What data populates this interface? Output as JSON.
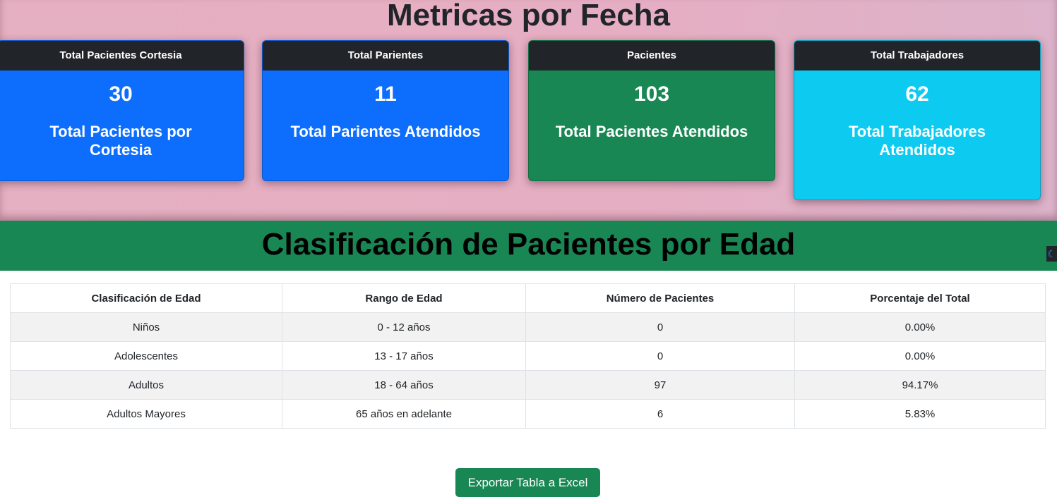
{
  "header": {
    "title": "Metricas por Fecha"
  },
  "cards": [
    {
      "header": "Total Pacientes Cortesia",
      "value": "30",
      "description": "Total Pacientes por Cortesia",
      "color": "#0d6efd"
    },
    {
      "header": "Total Parientes",
      "value": "11",
      "description": "Total Parientes Atendidos",
      "color": "#0d6efd"
    },
    {
      "header": "Pacientes",
      "value": "103",
      "description": "Total Pacientes Atendidos",
      "color": "#198754"
    },
    {
      "header": "Total Trabajadores",
      "value": "62",
      "description": "Total Trabajadores Atendidos",
      "color": "#0dcaf0"
    }
  ],
  "classification": {
    "title": "Clasificación de Pacientes por Edad",
    "theme_toggle_icon": "moon-icon",
    "columns": [
      "Clasificación de Edad",
      "Rango de Edad",
      "Número de Pacientes",
      "Porcentaje del Total"
    ],
    "rows": [
      [
        "Niños",
        "0 - 12 años",
        "0",
        "0.00%"
      ],
      [
        "Adolescentes",
        "13 - 17 años",
        "0",
        "0.00%"
      ],
      [
        "Adultos",
        "18 - 64 años",
        "97",
        "94.17%"
      ],
      [
        "Adultos Mayores",
        "65 años en adelante",
        "6",
        "5.83%"
      ]
    ]
  },
  "actions": {
    "export_label": "Exportar Tabla a Excel"
  },
  "colors": {
    "primary": "#0d6efd",
    "success": "#198754",
    "info": "#0dcaf0",
    "dark": "#212529"
  }
}
